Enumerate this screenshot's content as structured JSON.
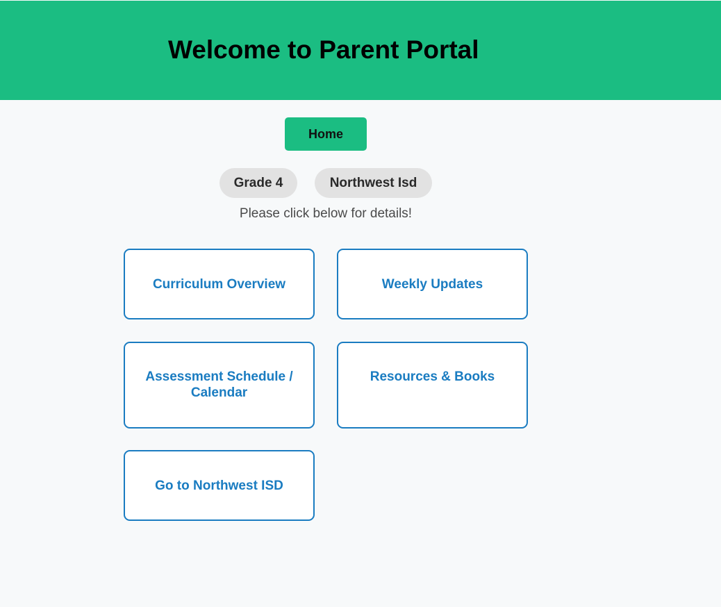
{
  "header": {
    "title": "Welcome to Parent Portal",
    "background_color": "#1bbd82"
  },
  "nav": {
    "home_label": "Home"
  },
  "tags": [
    {
      "label": "Grade 4"
    },
    {
      "label": "Northwest Isd"
    }
  ],
  "instructions": "Please click below for details!",
  "cards": [
    {
      "label": "Curriculum Overview"
    },
    {
      "label": "Weekly Updates"
    },
    {
      "label": "Assessment Schedule / Calendar"
    },
    {
      "label": "Resources & Books"
    },
    {
      "label": "Go to Northwest ISD"
    }
  ],
  "colors": {
    "accent": "#1bbd82",
    "link": "#1a7cc1",
    "tag_bg": "#e2e2e2",
    "page_bg": "#f7f9fa"
  }
}
